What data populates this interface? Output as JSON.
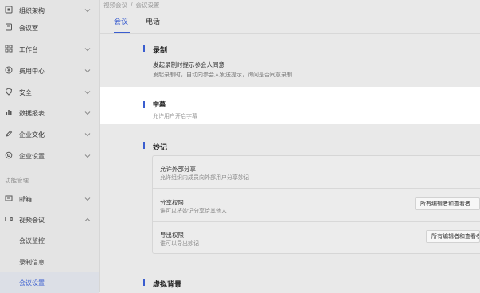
{
  "sidebar": {
    "items": [
      {
        "icon": "org-chart-icon",
        "label": "组织架构",
        "expandable": true
      },
      {
        "icon": "meeting-room-icon",
        "label": "会议室",
        "expandable": false
      },
      {
        "icon": "workbench-icon",
        "label": "工作台",
        "expandable": true
      },
      {
        "icon": "billing-icon",
        "label": "费用中心",
        "expandable": true
      },
      {
        "icon": "shield-icon",
        "label": "安全",
        "expandable": true
      },
      {
        "icon": "report-icon",
        "label": "数据报表",
        "expandable": true
      },
      {
        "icon": "pen-icon",
        "label": "企业文化",
        "expandable": true
      },
      {
        "icon": "gear-icon",
        "label": "企业设置",
        "expandable": true
      }
    ],
    "section_label": "功能管理",
    "mail": {
      "icon": "mail-icon",
      "label": "邮箱"
    },
    "video": {
      "icon": "video-icon",
      "label": "视频会议"
    },
    "video_sub": [
      "会议监控",
      "录制信息",
      "会议设置"
    ]
  },
  "breadcrumb": {
    "parent": "视频会议",
    "sep": "/",
    "current": "会议设置"
  },
  "tabs": [
    "会议",
    "电话"
  ],
  "active_tab": 0,
  "sections": {
    "record": {
      "title": "录制",
      "label": "发起录制时提示参会人同意",
      "desc": "发起录制时，自动向参会人发送提示，询问是否同意录制"
    },
    "subtitle": {
      "title": "字幕",
      "desc": "允许用户开启字幕"
    },
    "minutes": {
      "title": "妙记",
      "rows": [
        {
          "title": "允许外部分享",
          "desc": "允许组织内成员向外部用户分享妙记"
        },
        {
          "title": "分享权限",
          "desc": "谁可以将妙记分享给其他人",
          "select": "所有编辑者和查看者"
        },
        {
          "title": "导出权限",
          "desc": "谁可以导出妙记",
          "select": "所有编辑者和查看者"
        }
      ]
    },
    "virtual_bg": {
      "title": "虚拟背景"
    }
  },
  "colors": {
    "accent": "#3a5dcf",
    "sidebar_bg": "#e4e4e4",
    "content_bg": "#e9e9e9"
  }
}
